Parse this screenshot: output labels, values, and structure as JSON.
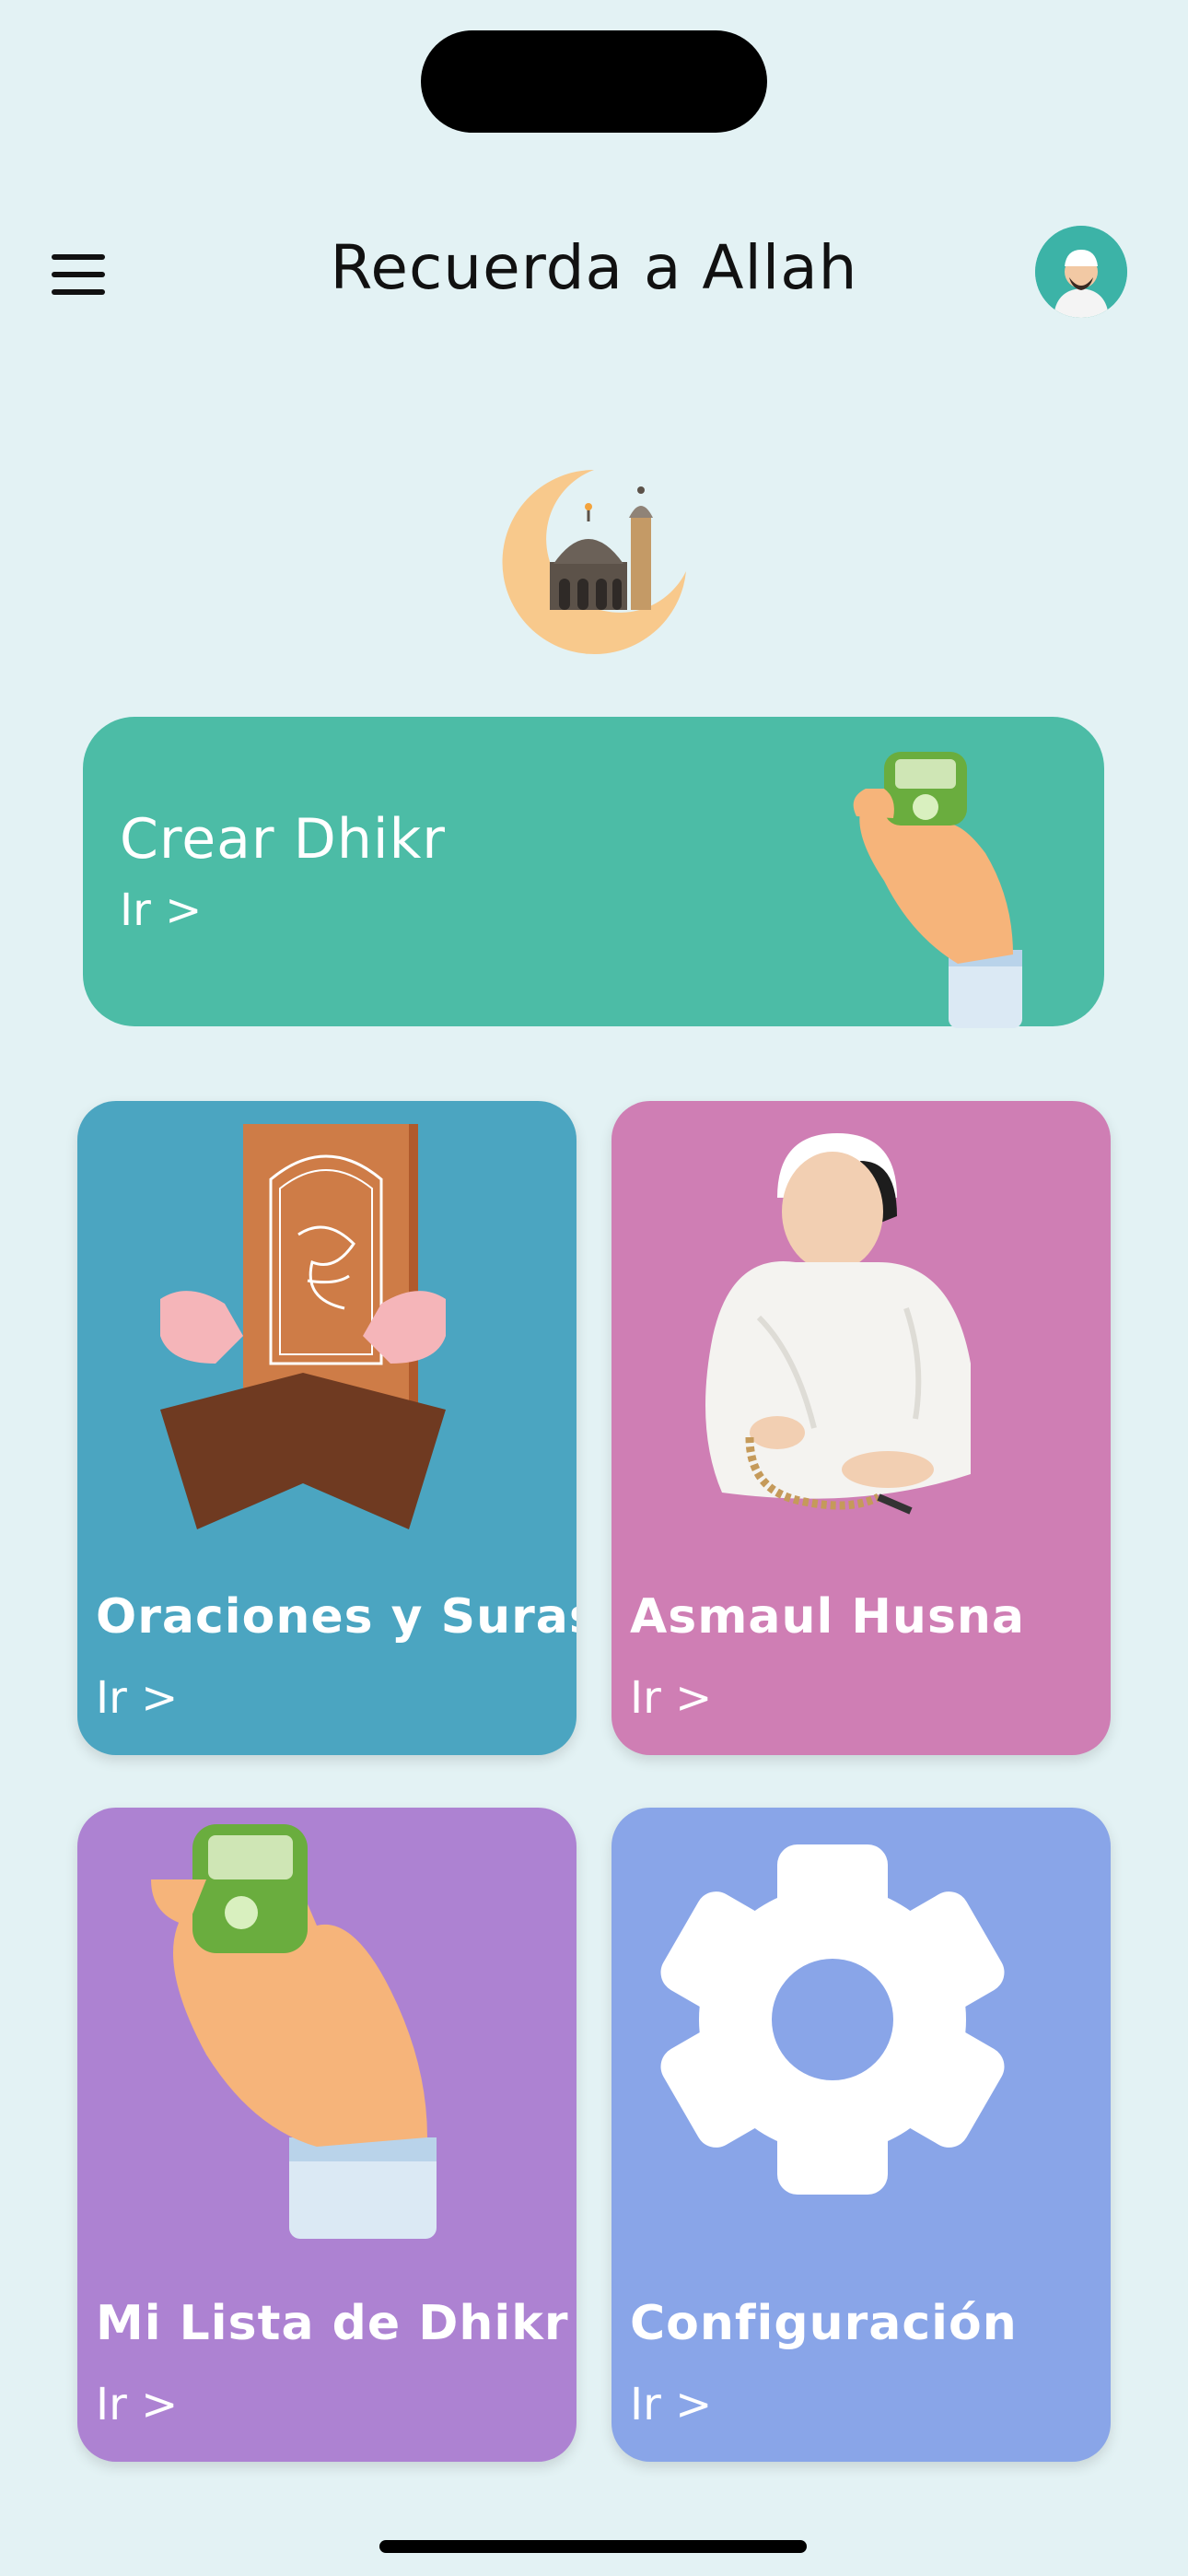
{
  "header": {
    "title": "Recuerda a Allah",
    "menu_icon": "hamburger-menu-icon",
    "avatar_icon": "user-avatar-icon"
  },
  "logo": {
    "icon": "crescent-mosque-icon"
  },
  "banner": {
    "title": "Crear Dhikr",
    "go_label": "Ir >",
    "icon": "tasbih-counter-hand-icon"
  },
  "cards": [
    {
      "title": "Oraciones y Suras",
      "go_label": "Ir >",
      "icon": "quran-book-icon",
      "color": "#4ba5c1"
    },
    {
      "title": "Asmaul Husna",
      "go_label": "Ir >",
      "icon": "praying-man-icon",
      "color": "#cf7eb4"
    },
    {
      "title": "Mi Lista de Dhikr",
      "go_label": "Ir >",
      "icon": "tasbih-counter-hand-icon",
      "color": "#ad82d2"
    },
    {
      "title": "Configuración",
      "go_label": "Ir >",
      "icon": "gear-icon",
      "color": "#89a5e8"
    }
  ],
  "colors": {
    "background": "#e3f2f4",
    "banner": "#4cbca6"
  }
}
